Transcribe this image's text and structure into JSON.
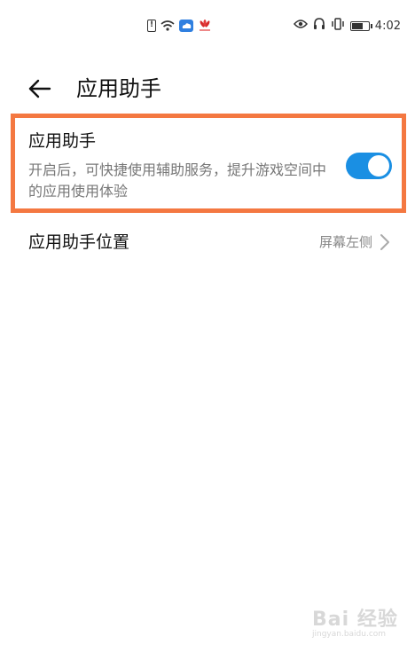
{
  "status_bar": {
    "time": "4:02",
    "icons": [
      "sim-alert-icon",
      "wifi-icon",
      "cloud-icon",
      "huawei-logo-icon",
      "eye-icon",
      "headphones-icon",
      "vibrate-icon",
      "battery-icon"
    ],
    "battery_level": 0.6
  },
  "header": {
    "back_icon": "arrow-left-icon",
    "title": "应用助手"
  },
  "assistant_setting": {
    "title": "应用助手",
    "description": "开启后，可快捷使用辅助服务，提升游戏空间中的应用使用体验",
    "enabled": true,
    "toggle_color": "#1a8fe3",
    "highlight_color": "#f47841"
  },
  "position_setting": {
    "label": "应用助手位置",
    "value": "屏幕左侧",
    "chevron_icon": "chevron-right-icon"
  },
  "watermark": {
    "main": "Bai 经验",
    "sub": "jingyan.baidu.com"
  }
}
